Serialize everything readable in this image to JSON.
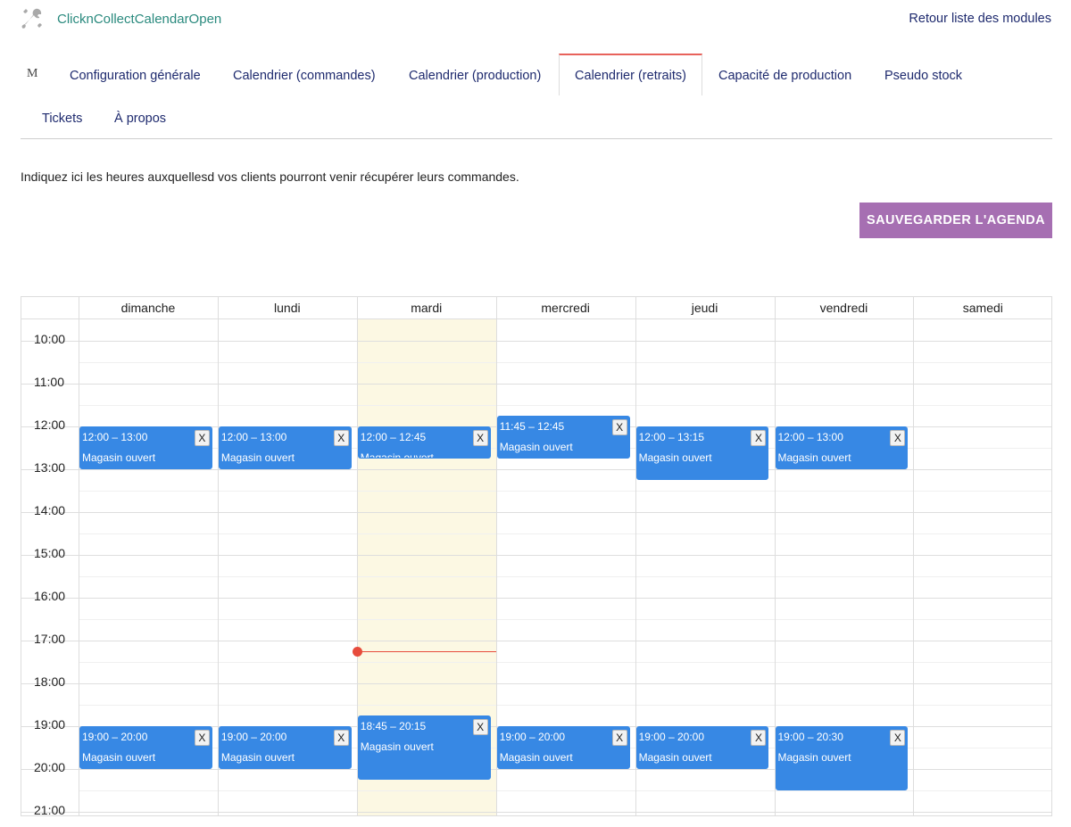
{
  "header": {
    "icon": "tools-icon",
    "title": "ClicknCollectCalendarOpen",
    "back_link": "Retour liste des modules"
  },
  "tabs": [
    {
      "label": "M",
      "name": "tab-logo"
    },
    {
      "label": "Configuration générale",
      "name": "tab-configuration-generale"
    },
    {
      "label": "Calendrier (commandes)",
      "name": "tab-calendrier-commandes"
    },
    {
      "label": "Calendrier (production)",
      "name": "tab-calendrier-production"
    },
    {
      "label": "Calendrier (retraits)",
      "name": "tab-calendrier-retraits",
      "active": true
    },
    {
      "label": "Capacité de production",
      "name": "tab-capacite-production"
    },
    {
      "label": "Pseudo stock",
      "name": "tab-pseudo-stock"
    },
    {
      "label": "Tickets",
      "name": "tab-tickets"
    },
    {
      "label": "À propos",
      "name": "tab-a-propos"
    }
  ],
  "intro_text": "Indiquez ici les heures auxquellesd vos clients pourront venir récupérer leurs commandes.",
  "save_button": "SAUVEGARDER L'AGENDA",
  "colors": {
    "accent_tab": "#e8625b",
    "save_button": "#a66fb2",
    "event": "#3788e4",
    "today": "#fcf8e3",
    "now_indicator": "#e74c3c",
    "title": "#2a8a7e",
    "link": "#1e2a6e"
  },
  "calendar": {
    "days": [
      "dimanche",
      "lundi",
      "mardi",
      "mercredi",
      "jeudi",
      "vendredi",
      "samedi"
    ],
    "today_index": 2,
    "start_hour": 9.5,
    "hours": [
      "10:00",
      "11:00",
      "12:00",
      "13:00",
      "14:00",
      "15:00",
      "16:00",
      "17:00",
      "18:00",
      "19:00",
      "20:00",
      "21:00"
    ],
    "now": 17.25,
    "close_label": "X",
    "events": [
      {
        "day": 0,
        "start": 12.0,
        "end": 13.0,
        "time": "12:00 – 13:00",
        "title": "Magasin ouvert"
      },
      {
        "day": 1,
        "start": 12.0,
        "end": 13.0,
        "time": "12:00 – 13:00",
        "title": "Magasin ouvert"
      },
      {
        "day": 2,
        "start": 12.0,
        "end": 12.75,
        "time": "12:00 – 12:45",
        "title": "Magasin ouvert"
      },
      {
        "day": 3,
        "start": 11.75,
        "end": 12.75,
        "time": "11:45 – 12:45",
        "title": "Magasin ouvert"
      },
      {
        "day": 4,
        "start": 12.0,
        "end": 13.25,
        "time": "12:00 – 13:15",
        "title": "Magasin ouvert"
      },
      {
        "day": 5,
        "start": 12.0,
        "end": 13.0,
        "time": "12:00 – 13:00",
        "title": "Magasin ouvert"
      },
      {
        "day": 0,
        "start": 19.0,
        "end": 20.0,
        "time": "19:00 – 20:00",
        "title": "Magasin ouvert"
      },
      {
        "day": 1,
        "start": 19.0,
        "end": 20.0,
        "time": "19:00 – 20:00",
        "title": "Magasin ouvert"
      },
      {
        "day": 2,
        "start": 18.75,
        "end": 20.25,
        "time": "18:45 – 20:15",
        "title": "Magasin ouvert"
      },
      {
        "day": 3,
        "start": 19.0,
        "end": 20.0,
        "time": "19:00 – 20:00",
        "title": "Magasin ouvert"
      },
      {
        "day": 4,
        "start": 19.0,
        "end": 20.0,
        "time": "19:00 – 20:00",
        "title": "Magasin ouvert"
      },
      {
        "day": 5,
        "start": 19.0,
        "end": 20.5,
        "time": "19:00 – 20:30",
        "title": "Magasin ouvert"
      }
    ]
  }
}
